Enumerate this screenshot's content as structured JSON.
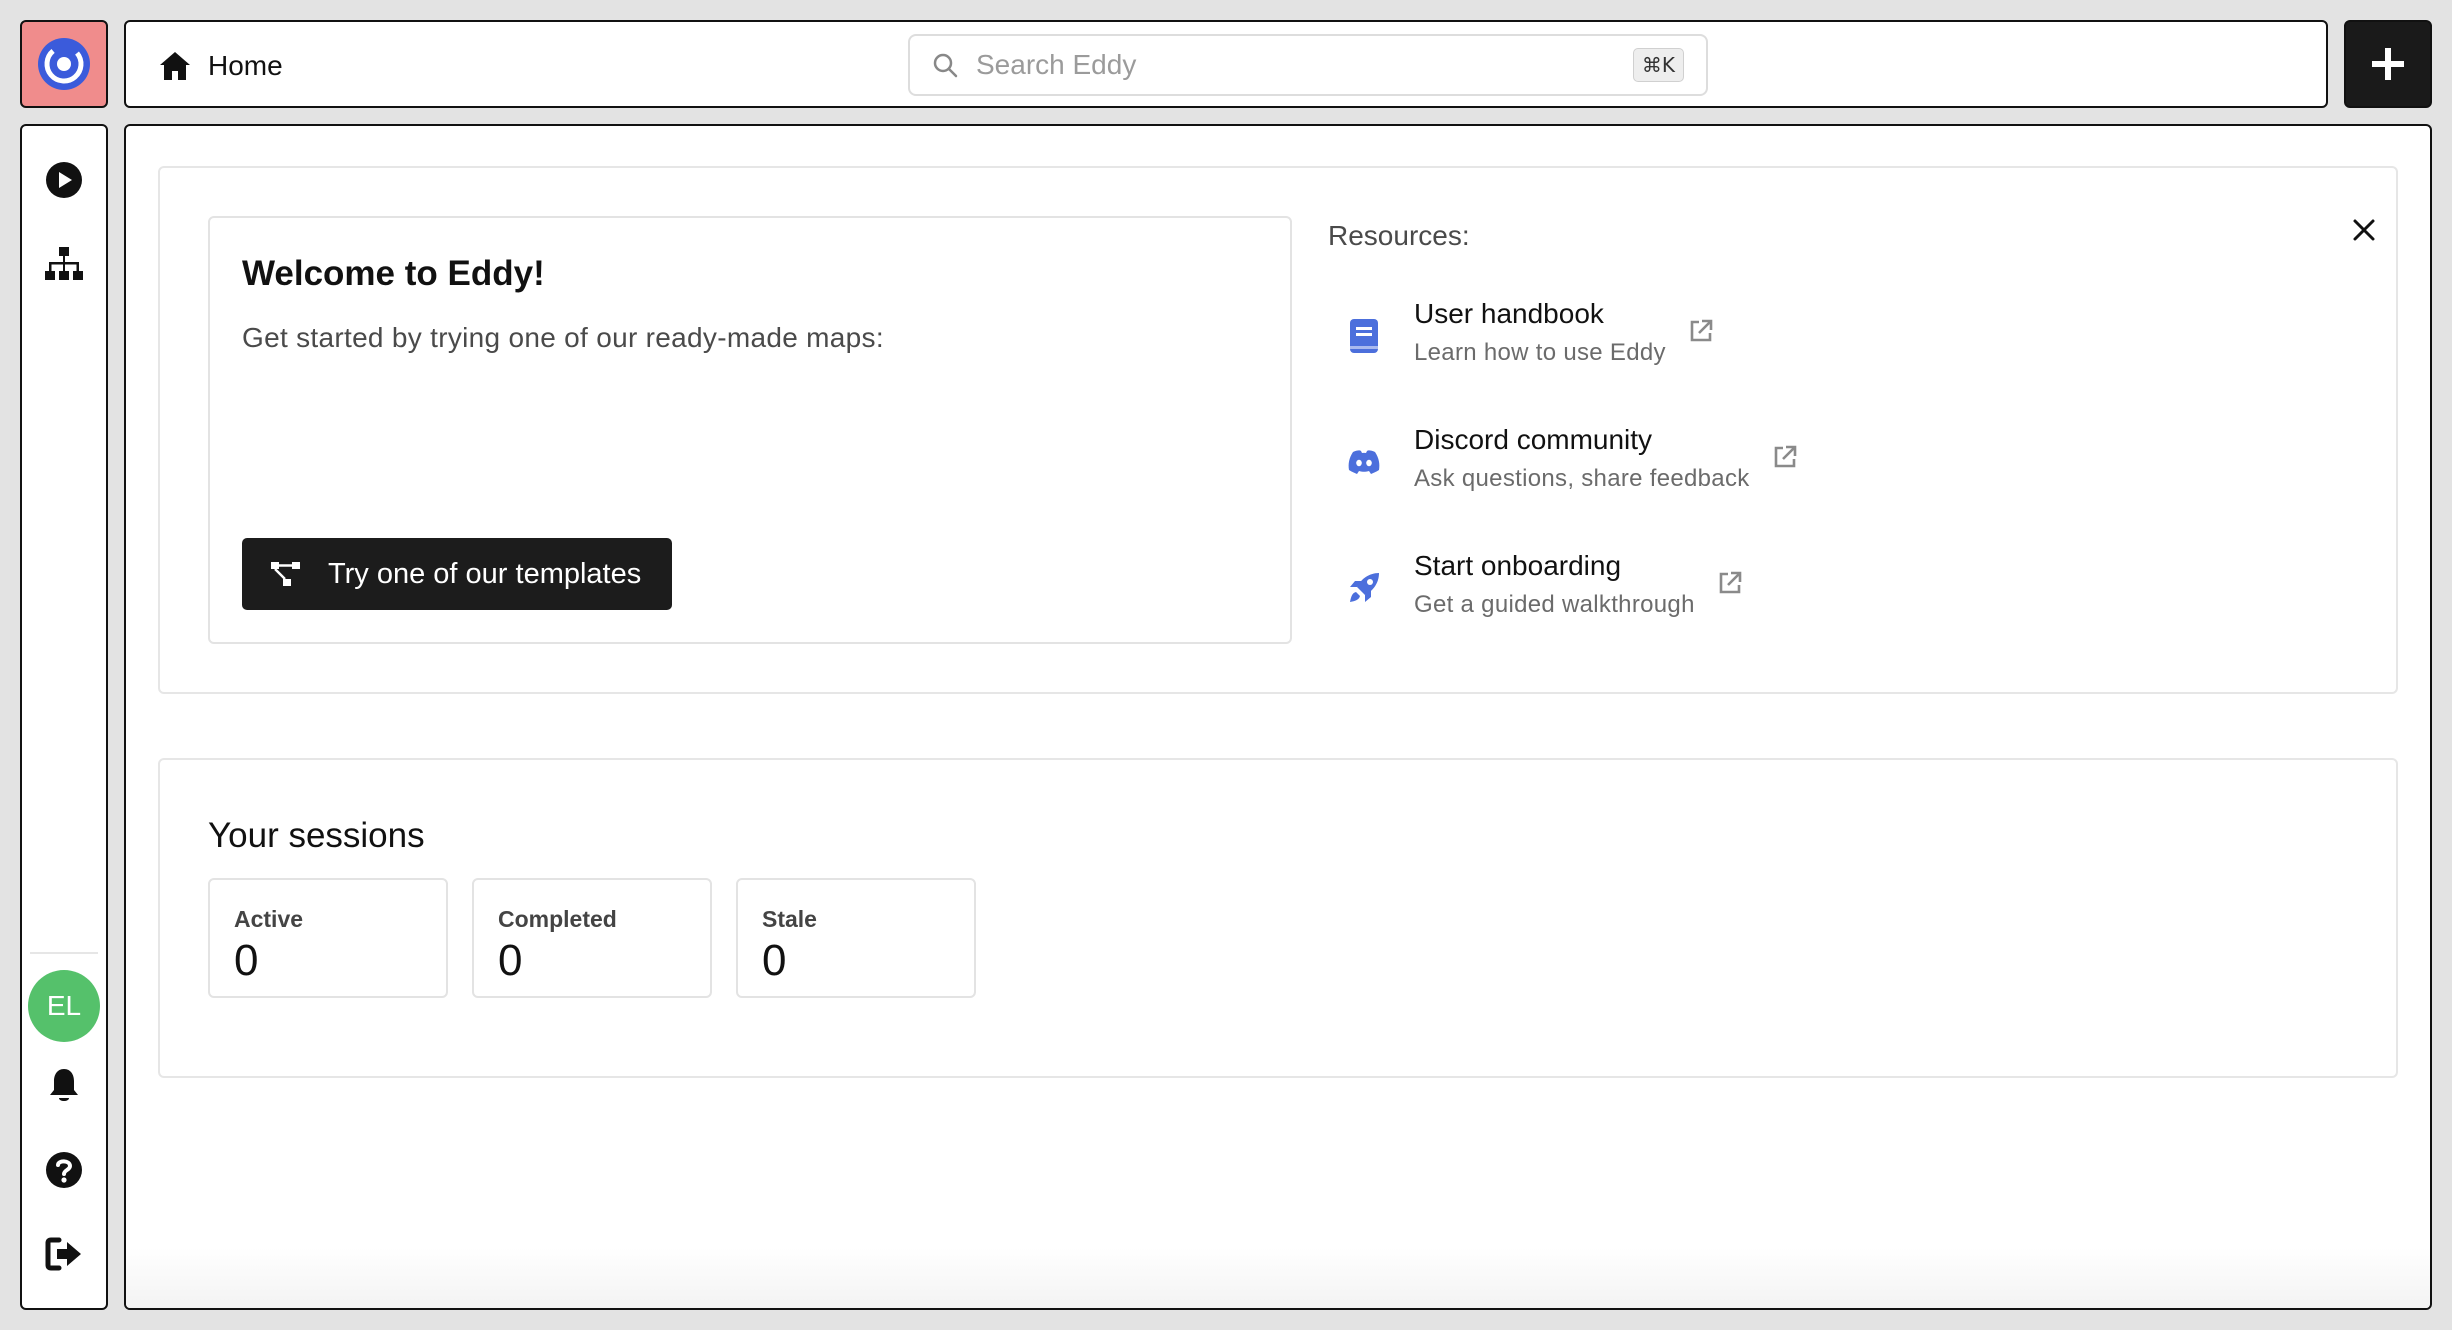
{
  "app": {
    "name": "Eddy",
    "accent": "#f08c8c",
    "logo_blue": "#3b5bdb"
  },
  "header": {
    "home_label": "Home",
    "search_placeholder": "Search Eddy",
    "search_shortcut": "⌘K",
    "add_icon": "plus-icon"
  },
  "sidebar": {
    "items": [
      {
        "name": "sessions",
        "icon": "play-circle-icon"
      },
      {
        "name": "maps",
        "icon": "sitemap-icon"
      }
    ],
    "avatar_initials": "EL",
    "avatar_color": "#55c16b",
    "bottom_items": [
      {
        "name": "notifications",
        "icon": "bell-icon"
      },
      {
        "name": "help",
        "icon": "question-circle-icon"
      },
      {
        "name": "logout",
        "icon": "sign-out-icon"
      }
    ]
  },
  "welcome": {
    "title": "Welcome to Eddy!",
    "subtitle": "Get started by trying one of our ready-made maps:",
    "templates_button": "Try one of our templates"
  },
  "resources": {
    "heading": "Resources:",
    "items": [
      {
        "title": "User handbook",
        "subtitle": "Learn how to use Eddy",
        "icon": "book-icon"
      },
      {
        "title": "Discord community",
        "subtitle": "Ask questions, share feedback",
        "icon": "discord-icon"
      },
      {
        "title": "Start onboarding",
        "subtitle": "Get a guided walkthrough",
        "icon": "rocket-icon"
      }
    ],
    "icon_color": "#4c6fdc"
  },
  "sessions": {
    "title": "Your sessions",
    "stats": [
      {
        "label": "Active",
        "value": "0"
      },
      {
        "label": "Completed",
        "value": "0"
      },
      {
        "label": "Stale",
        "value": "0"
      }
    ]
  }
}
